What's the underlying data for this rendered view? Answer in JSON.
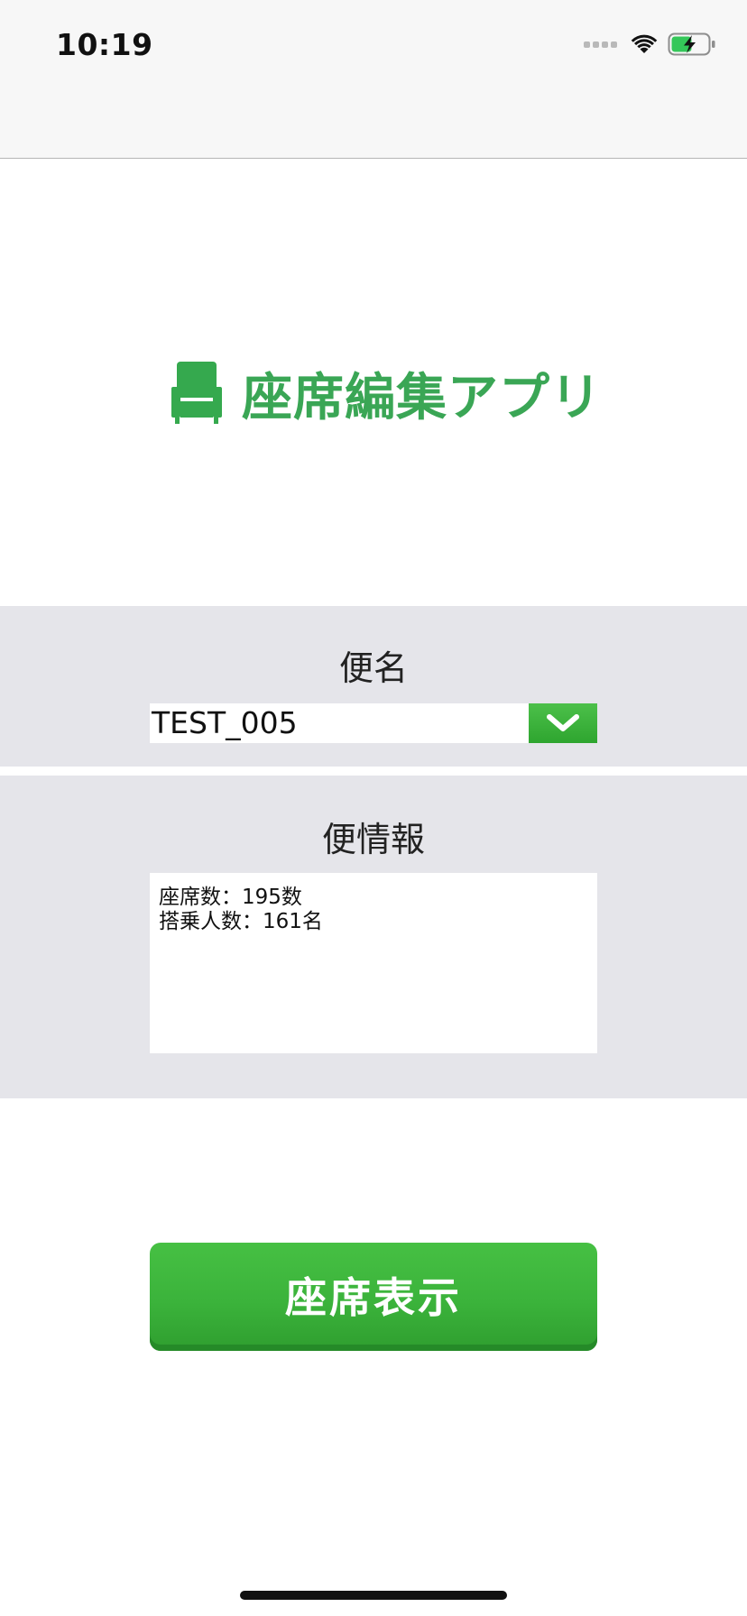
{
  "status_bar": {
    "time": "10:19"
  },
  "app": {
    "title": "座席編集アプリ",
    "logo_icon": "armchair-icon",
    "brand_color": "#3aa655"
  },
  "flight_panel": {
    "label": "便名",
    "selected_flight": "TEST_005",
    "dropdown_icon": "chevron-down-icon"
  },
  "info_panel": {
    "label": "便情報",
    "lines": [
      "座席数：195数",
      "搭乗人数：161名"
    ]
  },
  "actions": {
    "show_seats_label": "座席表示",
    "button_color": "#3bb33b"
  }
}
